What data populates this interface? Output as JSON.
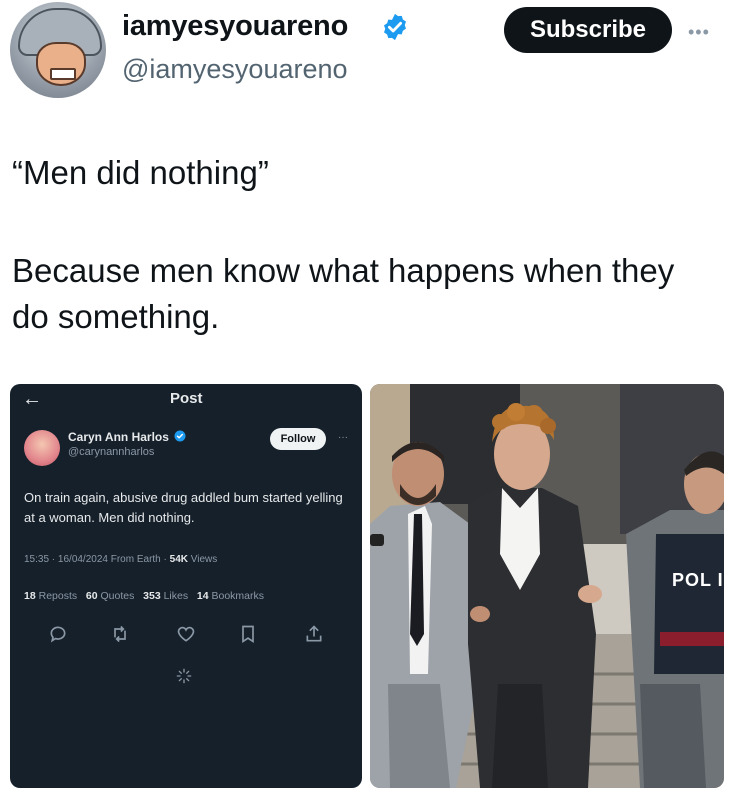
{
  "post": {
    "display_name": "iamyesyouareno",
    "handle": "@iamyesyouareno",
    "subscribe_label": "Subscribe",
    "more_label": "•••",
    "text_line1": "“Men did nothing”",
    "text_line2": "Because men know what happens when they do something."
  },
  "embedded": {
    "back_arrow": "←",
    "title": "Post",
    "author_name": "Caryn Ann Harlos",
    "author_handle": "@carynannharlos",
    "follow_label": "Follow",
    "more_label": "···",
    "text": "On train again, abusive drug addled bum started yelling at a woman. Men did nothing.",
    "meta_prefix": "15:35 · 16/04/2024 From Earth · ",
    "views_count": "54K",
    "views_label": " Views",
    "stats": [
      {
        "count": "18",
        "label": "Reposts"
      },
      {
        "count": "60",
        "label": "Quotes"
      },
      {
        "count": "353",
        "label": "Likes"
      },
      {
        "count": "14",
        "label": "Bookmarks"
      }
    ],
    "actions": [
      "reply-icon",
      "repost-icon",
      "like-icon",
      "bookmark-icon",
      "share-icon"
    ]
  },
  "photo": {
    "badge_text": "POL I"
  },
  "colors": {
    "verified": "#1d9bf0",
    "dark_panel": "#15202b",
    "subscribe_bg": "#0f1419"
  }
}
